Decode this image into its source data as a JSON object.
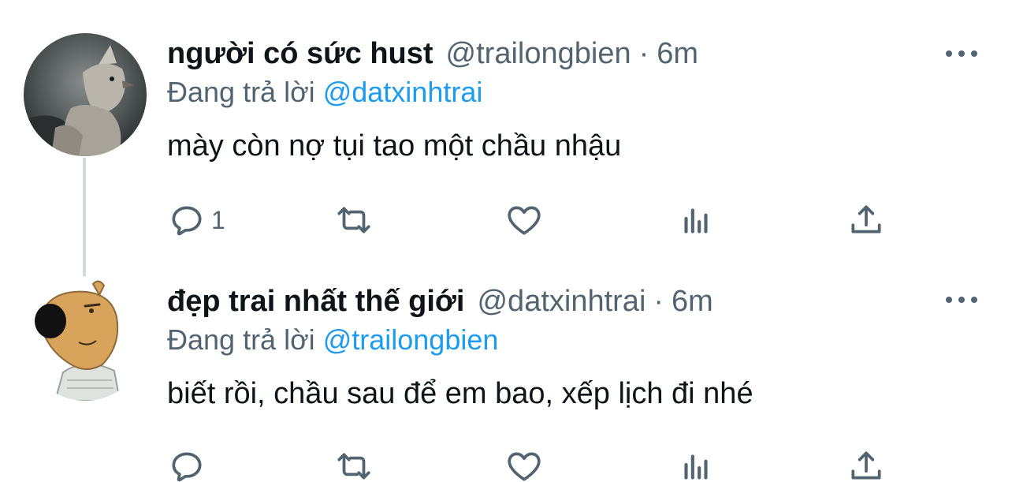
{
  "tweets": [
    {
      "display_name": "người có sức hust",
      "handle": "@trailongbien",
      "separator": "·",
      "time": "6m",
      "reply_prefix": "Đang trả lời",
      "reply_to": "@datxinhtrai",
      "text": "mày còn nợ tụi tao một chầu nhậu",
      "reply_count": "1",
      "avatar_icon": "wolf-avatar"
    },
    {
      "display_name": "đẹp trai nhất thế giới",
      "handle": "@datxinhtrai",
      "separator": "·",
      "time": "6m",
      "reply_prefix": "Đang trả lời",
      "reply_to": "@trailongbien",
      "text": "biết rồi, chầu sau để em bao, xếp lịch đi nhé",
      "reply_count": "",
      "avatar_icon": "capybara-avatar"
    }
  ],
  "icons": {
    "more": "more-dots-icon",
    "reply": "reply-icon",
    "retweet": "retweet-icon",
    "like": "heart-icon",
    "stats": "stats-icon",
    "share": "share-icon"
  },
  "colors": {
    "text": "#0f1419",
    "secondary": "#536471",
    "link": "#1d9bf0",
    "thread_line": "#cfd9de"
  }
}
